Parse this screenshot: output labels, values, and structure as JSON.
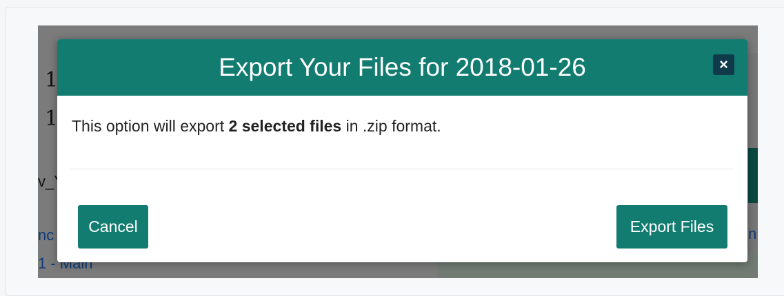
{
  "background": {
    "line1": "1",
    "line2": "1",
    "fragment": "v_Y",
    "link1": "nc",
    "link2": "1 - Main",
    "side": "n"
  },
  "modal": {
    "title": "Export Your Files for 2018-01-26",
    "close_label": "×",
    "body": {
      "prefix": "This option will export ",
      "emphasis": "2 selected files",
      "suffix": " in .zip format."
    },
    "cancel_label": "Cancel",
    "export_label": "Export Files"
  },
  "colors": {
    "header": "#127c70",
    "button": "#127c70",
    "close": "#0f3a4a",
    "overlay": "#7b7b7b"
  }
}
